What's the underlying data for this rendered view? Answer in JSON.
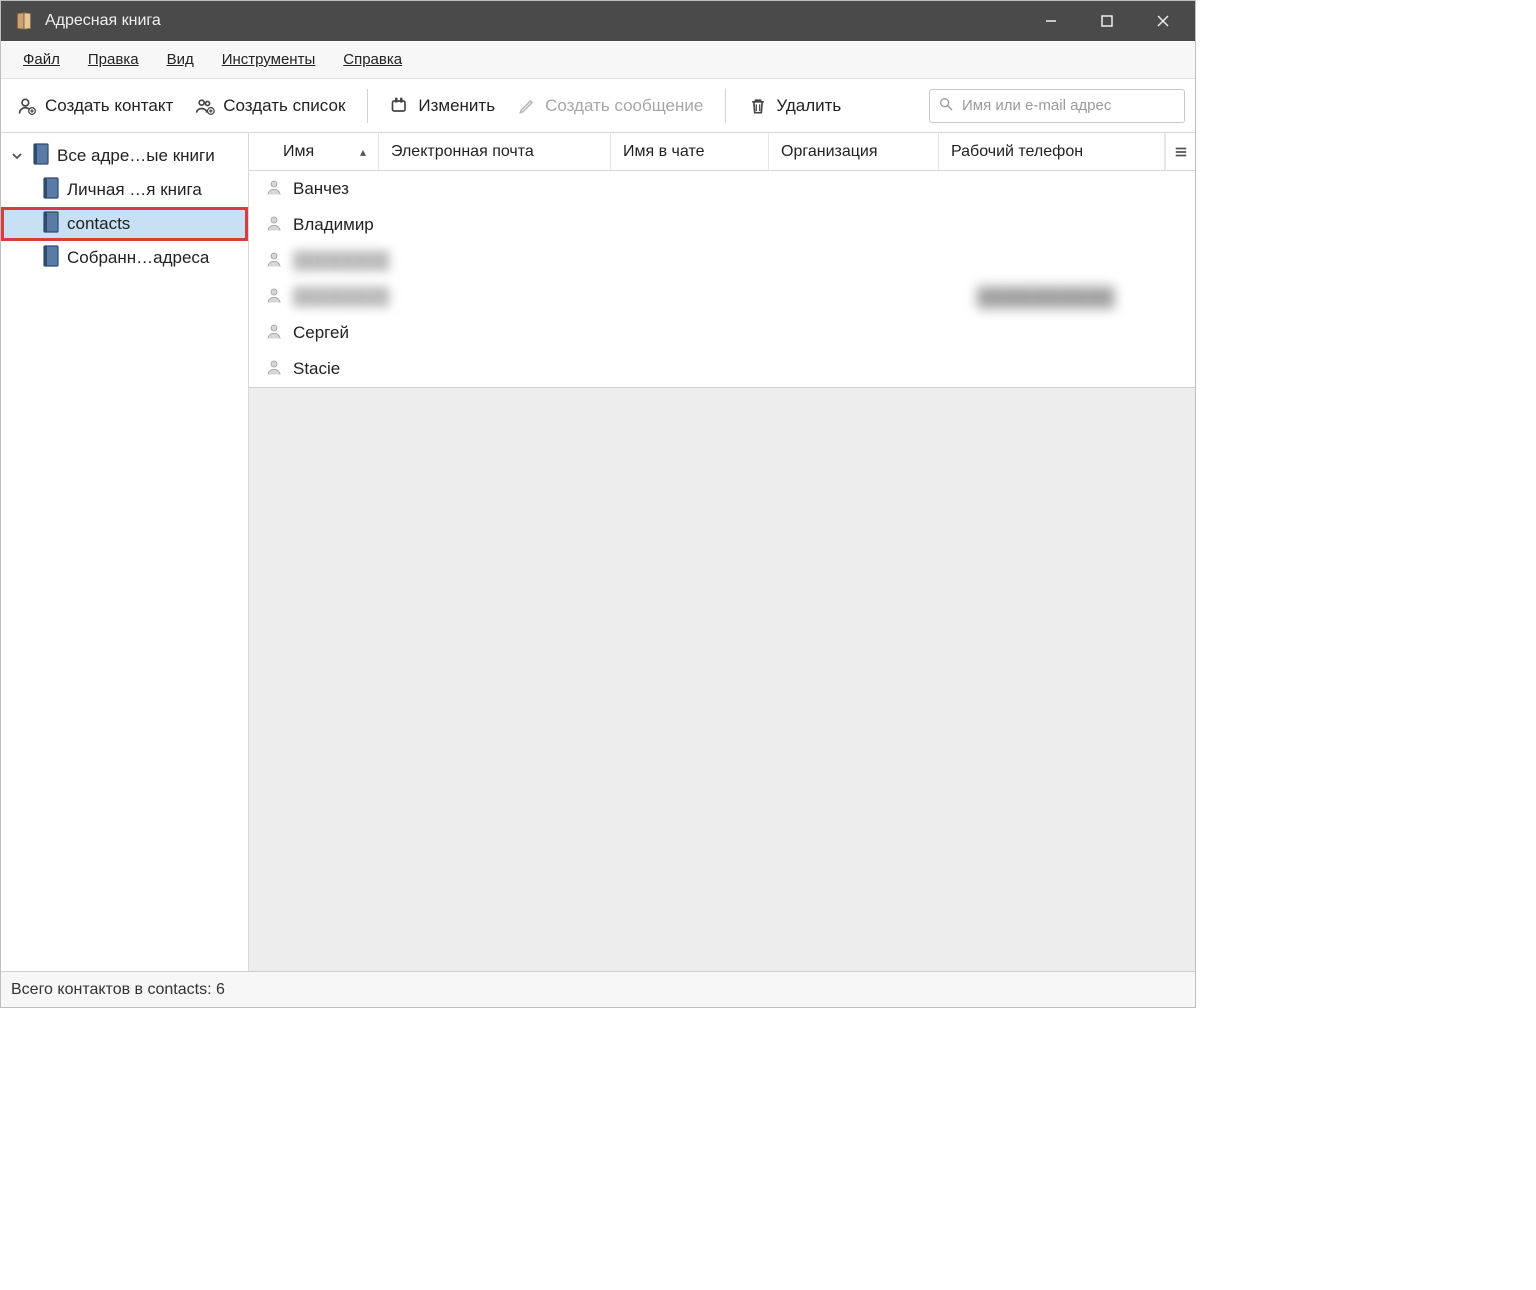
{
  "window": {
    "title": "Адресная книга"
  },
  "menu": {
    "file": "Файл",
    "edit": "Правка",
    "view": "Вид",
    "tools": "Инструменты",
    "help": "Справка"
  },
  "toolbar": {
    "new_contact": "Создать контакт",
    "new_list": "Создать список",
    "edit": "Изменить",
    "compose": "Создать сообщение",
    "delete": "Удалить",
    "search_placeholder": "Имя или e-mail адрес"
  },
  "sidebar": {
    "root": "Все адре…ые книги",
    "items": [
      {
        "label": "Личная …я книга"
      },
      {
        "label": "contacts",
        "selected": true
      },
      {
        "label": "Собранн…адреса"
      }
    ]
  },
  "columns": {
    "name": "Имя",
    "email": "Электронная почта",
    "chat_name": "Имя в чате",
    "organization": "Организация",
    "work_phone": "Рабочий телефон"
  },
  "contacts": [
    {
      "name": "Ванчез"
    },
    {
      "name": "Владимир"
    },
    {
      "name": "████████",
      "blurred": true
    },
    {
      "name": "████████",
      "blurred": true,
      "work_phone": "██████████"
    },
    {
      "name": "Сергей"
    },
    {
      "name": "Stacie"
    }
  ],
  "status": {
    "text": "Всего контактов в contacts: 6"
  }
}
